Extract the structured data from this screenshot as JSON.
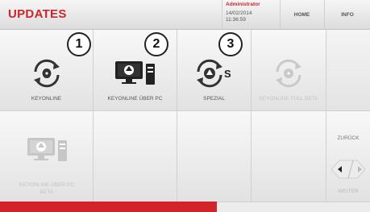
{
  "header": {
    "title": "UPDATES",
    "user": {
      "name": "Administrator",
      "date": "14/02/2014",
      "time": "11:36:59"
    },
    "nav": {
      "home": "HOME",
      "info": "INFO"
    }
  },
  "tiles": [
    {
      "label": "KEYONLINE",
      "icon": "keyonline-refresh-icon",
      "enabled": true
    },
    {
      "label": "KEYONLINE ÜBER PC",
      "icon": "computer-tower-icon",
      "enabled": true
    },
    {
      "label": "SPEZIAL",
      "icon": "special-refresh-icon",
      "enabled": true
    },
    {
      "label": "KEYONLINE FULL BETA",
      "icon": "keyonline-refresh-icon",
      "enabled": false
    },
    {
      "label": "KEYONLINE ÜBER PC BETA",
      "icon": "computer-tower-icon",
      "enabled": false
    }
  ],
  "badges": [
    "1",
    "2",
    "3"
  ],
  "pager": {
    "back_label": "ZURÜCK",
    "next_label": "WEITER"
  },
  "colors": {
    "accent": "#c8262e",
    "red_bar": "#d2232a"
  }
}
